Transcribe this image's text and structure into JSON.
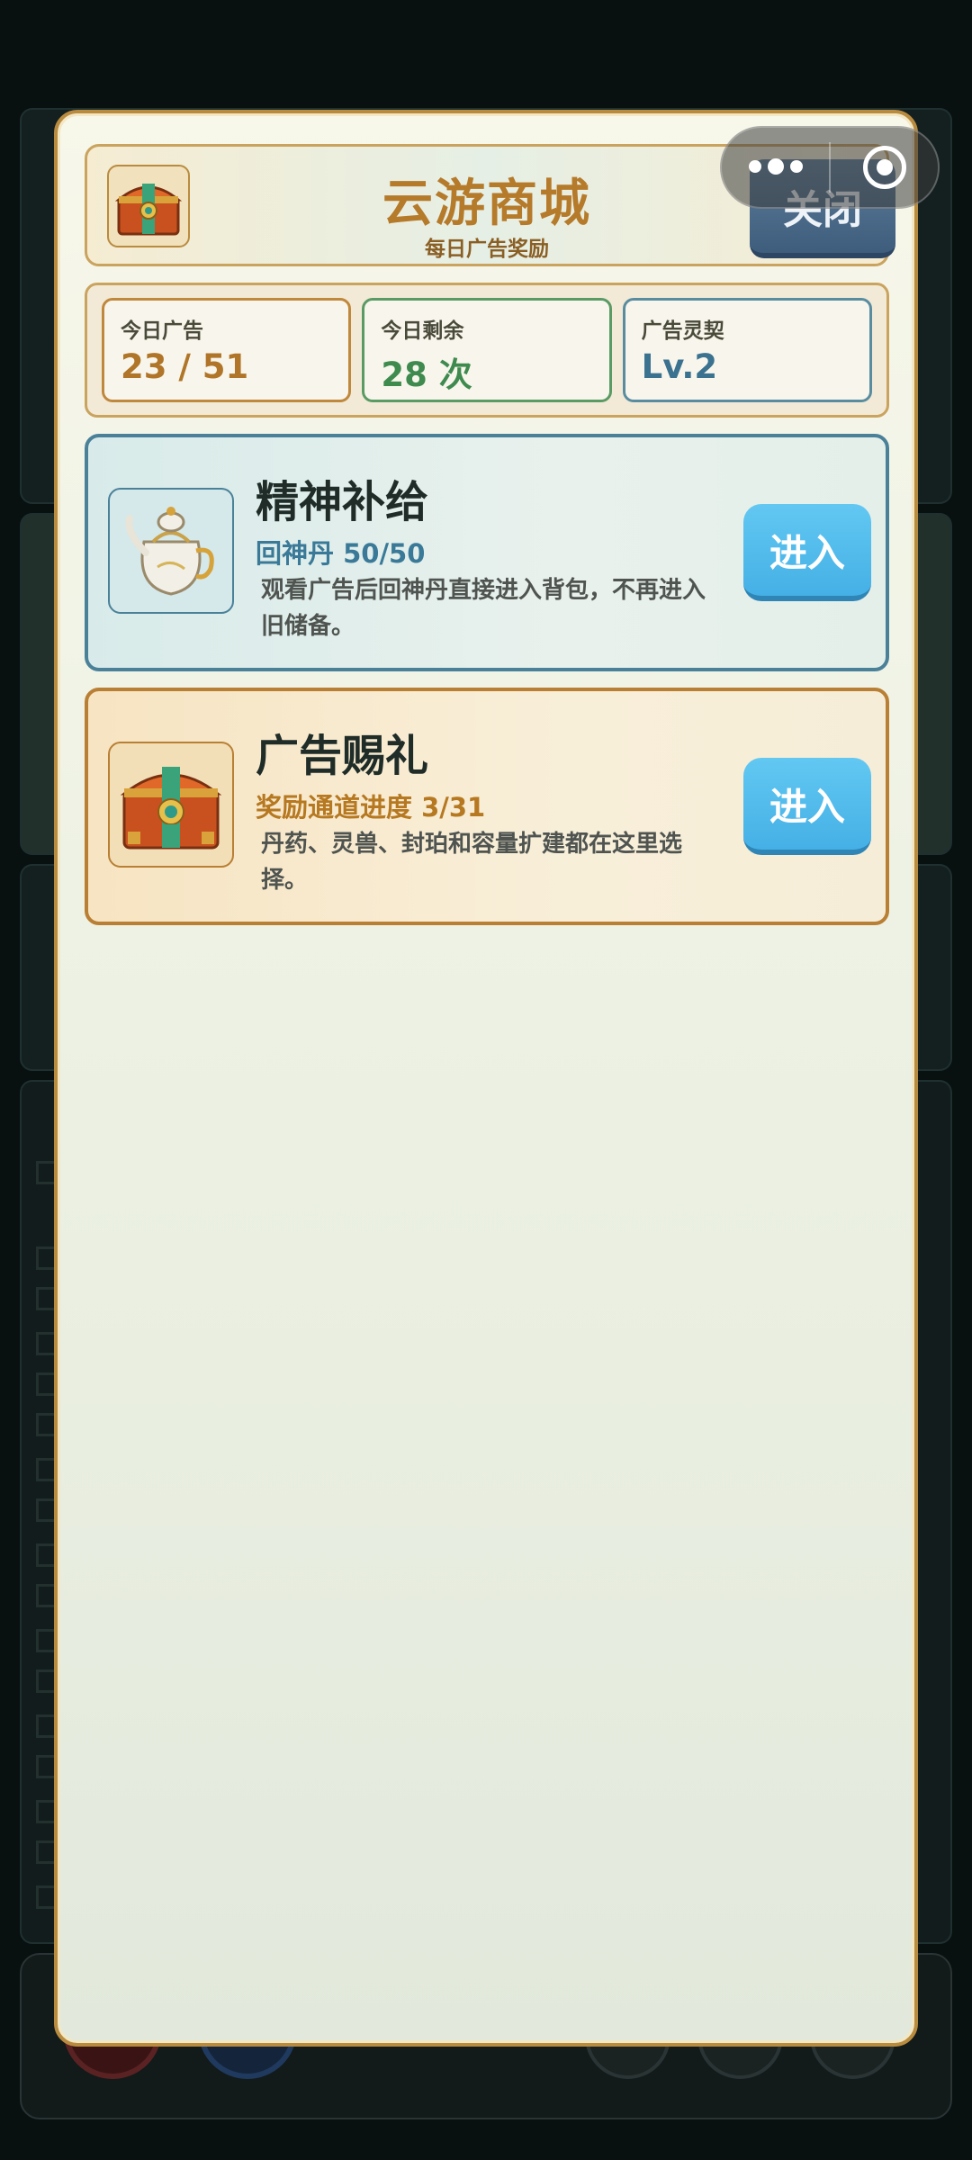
{
  "header": {
    "icon": "treasure-chest-icon",
    "title": "云游商城",
    "subtitle": "每日广告奖励",
    "close_label": "关闭"
  },
  "capsule": {
    "more_icon": "more-dots-icon",
    "close_icon": "target-ring-icon"
  },
  "stats": [
    {
      "label": "今日广告",
      "value": "23 / 51"
    },
    {
      "label": "今日剩余",
      "value": "28 次"
    },
    {
      "label": "广告灵契",
      "value": "Lv.2"
    }
  ],
  "cards": [
    {
      "icon": "teapot-icon",
      "title": "精神补给",
      "subtitle": "回神丹 50/50",
      "description": "观看广告后回神丹直接进入背包，不再进入旧储备。",
      "button_label": "进入"
    },
    {
      "icon": "treasure-chest-icon",
      "title": "广告赐礼",
      "subtitle": "奖励通道进度 3/31",
      "description": "丹药、灵兽、封珀和容量扩建都在这里选择。",
      "button_label": "进入"
    }
  ],
  "colors": {
    "accent_gold": "#b57a2a",
    "accent_blue": "#45b0e6",
    "close_button": "#3e5d7c"
  }
}
